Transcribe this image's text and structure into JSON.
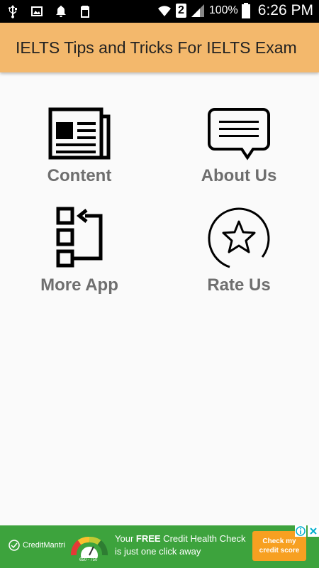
{
  "status_bar": {
    "sim": "2",
    "battery": "100%",
    "time": "6:26 PM"
  },
  "app_bar": {
    "title": "IELTS Tips and Tricks For IELTS Exam"
  },
  "menu": {
    "content": "Content",
    "about": "About Us",
    "more": "More App",
    "rate": "Rate Us"
  },
  "ad": {
    "brand": "CreditMantri",
    "gauge_range": "650 - 750",
    "line1_prefix": "Your ",
    "line1_bold": "FREE",
    "line1_suffix": " Credit Health Check",
    "line2": "is just one click away",
    "cta": "Check my credit score",
    "colors": {
      "background": "#3da33d",
      "cta": "#f7a021"
    }
  },
  "colors": {
    "app_bar": "#f3b86c",
    "menu_label": "#6e6e6e"
  }
}
